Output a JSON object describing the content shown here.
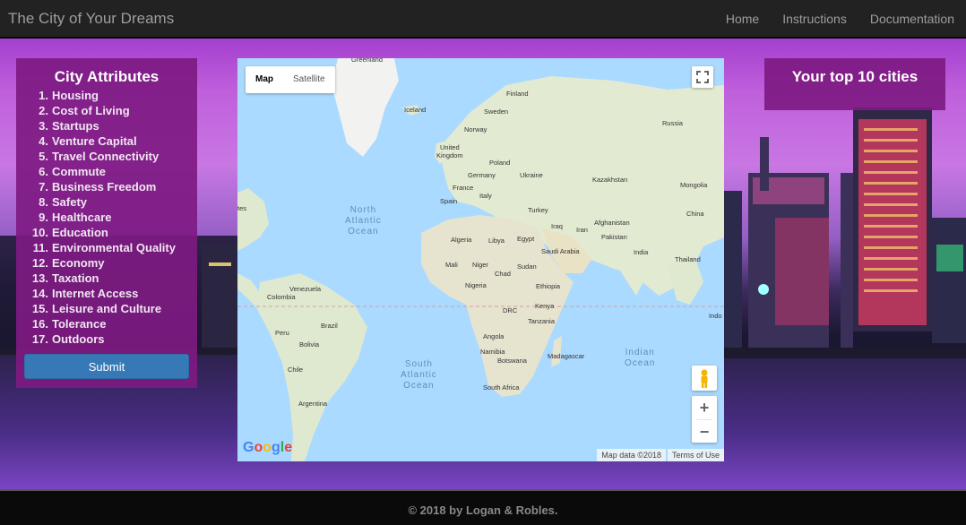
{
  "brand": "The City of Your Dreams",
  "nav": [
    {
      "label": "Home"
    },
    {
      "label": "Instructions"
    },
    {
      "label": "Documentation"
    }
  ],
  "attributes_panel": {
    "title": "City Attributes",
    "items": [
      {
        "num": "1.",
        "label": "Housing"
      },
      {
        "num": "2.",
        "label": "Cost of Living"
      },
      {
        "num": "3.",
        "label": "Startups"
      },
      {
        "num": "4.",
        "label": "Venture Capital"
      },
      {
        "num": "5.",
        "label": "Travel Connectivity"
      },
      {
        "num": "6.",
        "label": "Commute"
      },
      {
        "num": "7.",
        "label": "Business Freedom"
      },
      {
        "num": "8.",
        "label": "Safety"
      },
      {
        "num": "9.",
        "label": "Healthcare"
      },
      {
        "num": "10.",
        "label": "Education"
      },
      {
        "num": "11.",
        "label": "Environmental Quality"
      },
      {
        "num": "12.",
        "label": "Economy"
      },
      {
        "num": "13.",
        "label": "Taxation"
      },
      {
        "num": "14.",
        "label": "Internet Access"
      },
      {
        "num": "15.",
        "label": "Leisure and Culture"
      },
      {
        "num": "16.",
        "label": "Tolerance"
      },
      {
        "num": "17.",
        "label": "Outdoors"
      }
    ],
    "submit_label": "Submit"
  },
  "map": {
    "type_map": "Map",
    "type_satellite": "Satellite",
    "google": "Google",
    "data_credit": "Map data ©2018",
    "terms": "Terms of Use",
    "zoom_in": "+",
    "zoom_out": "−",
    "oceans": {
      "north_atlantic": "North\nAtlantic\nOcean",
      "south_atlantic": "South\nAtlantic\nOcean",
      "indian": "Indian\nOcean"
    },
    "labels": {
      "greenland": "Greenland",
      "iceland": "Iceland",
      "finland": "Finland",
      "sweden": "Sweden",
      "norway": "Norway",
      "russia": "Russia",
      "uk": "United\nKingdom",
      "poland": "Poland",
      "germany": "Germany",
      "ukraine": "Ukraine",
      "france": "France",
      "kazakhstan": "Kazakhstan",
      "mongolia": "Mongolia",
      "italy": "Italy",
      "spain": "Spain",
      "turkey": "Turkey",
      "china": "China",
      "iraq": "Iraq",
      "afghanistan": "Afghanistan",
      "iran": "Iran",
      "algeria": "Algeria",
      "libya": "Libya",
      "egypt": "Egypt",
      "pakistan": "Pakistan",
      "saudi": "Saudi Arabia",
      "india": "India",
      "mali": "Mali",
      "niger": "Niger",
      "sudan": "Sudan",
      "chad": "Chad",
      "thailand": "Thailand",
      "nigeria": "Nigeria",
      "ethiopia": "Ethiopia",
      "venezuela": "Venezuela",
      "colombia": "Colombia",
      "kenya": "Kenya",
      "drc": "DRC",
      "brazil": "Brazil",
      "peru": "Peru",
      "tanzania": "Tanzania",
      "indo": "Indo",
      "bolivia": "Bolivia",
      "angola": "Angola",
      "namibia": "Namibia",
      "madagascar": "Madagascar",
      "botswana": "Botswana",
      "chile": "Chile",
      "southafrica": "South Africa",
      "argentina": "Argentina",
      "tes": "tes"
    }
  },
  "top_panel": {
    "title": "Your top 10 cities"
  },
  "footer": {
    "text": "© 2018 by Logan & Robles."
  }
}
